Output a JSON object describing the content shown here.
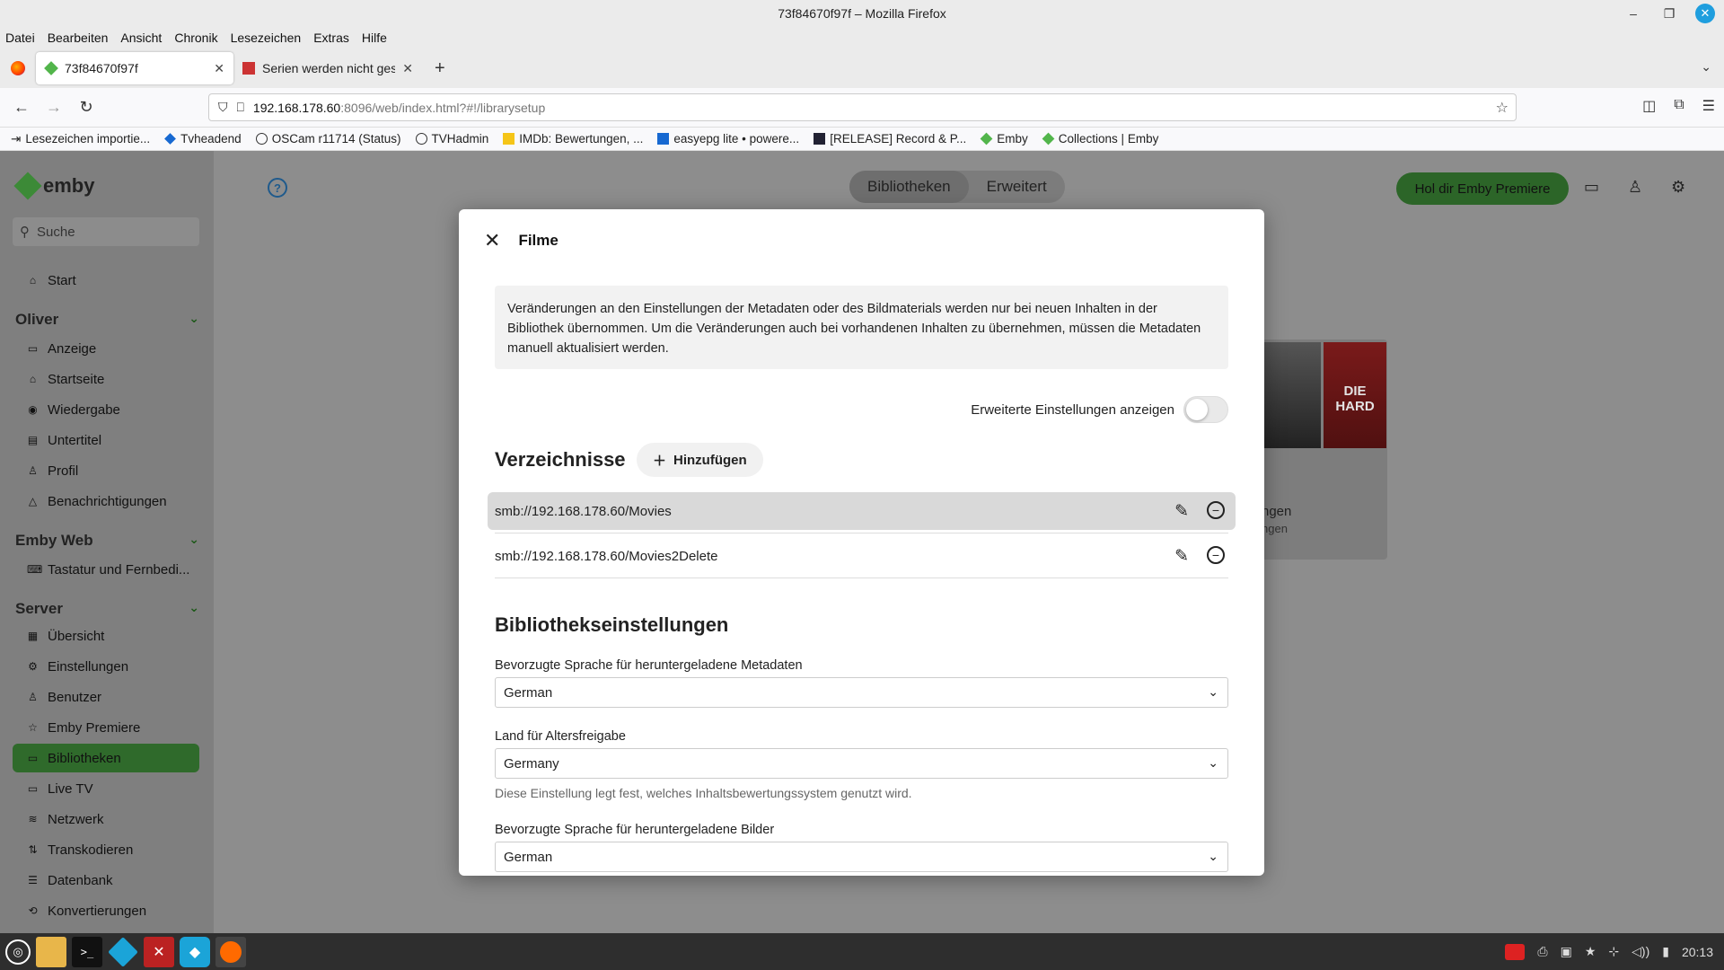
{
  "window": {
    "title": "73f84670f97f – Mozilla Firefox"
  },
  "menu": [
    "Datei",
    "Bearbeiten",
    "Ansicht",
    "Chronik",
    "Lesezeichen",
    "Extras",
    "Hilfe"
  ],
  "tabs": [
    {
      "label": "73f84670f97f",
      "active": true
    },
    {
      "label": "Serien werden nicht gescrap",
      "active": false
    }
  ],
  "url": {
    "host": "192.168.178.60",
    "rest": ":8096/web/index.html?#!/librarysetup"
  },
  "bookmarks": [
    {
      "label": "Lesezeichen importie...",
      "icon": "import-icon"
    },
    {
      "label": "Tvheadend",
      "icon": "tvheadend-icon"
    },
    {
      "label": "OSCam r11714 (Status)",
      "icon": "globe-icon"
    },
    {
      "label": "TVHadmin",
      "icon": "globe-icon"
    },
    {
      "label": "IMDb: Bewertungen, ...",
      "icon": "imdb-icon"
    },
    {
      "label": "easyepg lite • powere...",
      "icon": "easyepg-icon"
    },
    {
      "label": "[RELEASE] Record & P...",
      "icon": "kodi-icon"
    },
    {
      "label": "Emby",
      "icon": "emby-icon"
    },
    {
      "label": "Collections | Emby",
      "icon": "emby-icon"
    }
  ],
  "sidebar": {
    "logo": "emby",
    "search_placeholder": "Suche",
    "start": "Start",
    "sections": {
      "oliver": "Oliver",
      "emby_web": "Emby Web",
      "server": "Server"
    },
    "oliver_items": [
      "Anzeige",
      "Startseite",
      "Wiedergabe",
      "Untertitel",
      "Profil",
      "Benachrichtigungen"
    ],
    "emby_web_items": [
      "Tastatur und Fernbedi..."
    ],
    "server_items": [
      "Übersicht",
      "Einstellungen",
      "Benutzer",
      "Emby Premiere",
      "Bibliotheken",
      "Live TV",
      "Netzwerk",
      "Transkodieren",
      "Datenbank",
      "Konvertierungen"
    ]
  },
  "header": {
    "tabs": [
      "Bibliotheken",
      "Erweitert"
    ],
    "premiere_button": "Hol dir Emby Premiere"
  },
  "background_card": {
    "poster_text": "DIE HARD",
    "title": "ngen",
    "subtitle": "ngen"
  },
  "dialog": {
    "title": "Filme",
    "notice": "Veränderungen an den Einstellungen der Metadaten oder des Bildmaterials werden nur bei neuen Inhalten in der Bibliothek übernommen. Um die Veränderungen auch bei vorhandenen Inhalten zu übernehmen, müssen die Metadaten manuell aktualisiert werden.",
    "advanced_label": "Erweiterte Einstellungen anzeigen",
    "directories_title": "Verzeichnisse",
    "add_button": "Hinzufügen",
    "directories": [
      "smb://192.168.178.60/Movies",
      "smb://192.168.178.60/Movies2Delete"
    ],
    "library_settings_title": "Bibliothekseinstellungen",
    "fields": [
      {
        "label": "Bevorzugte Sprache für heruntergeladene Metadaten",
        "value": "German",
        "helper": ""
      },
      {
        "label": "Land für Altersfreigabe",
        "value": "Germany",
        "helper": "Diese Einstellung legt fest, welches Inhaltsbewertungssystem genutzt wird."
      },
      {
        "label": "Bevorzugte Sprache für heruntergeladene Bilder",
        "value": "German",
        "helper": ""
      }
    ]
  },
  "taskbar": {
    "clock": "20:13"
  },
  "colors": {
    "emby_green": "#52b54b",
    "active_dark_green": "#2f6a2b"
  }
}
